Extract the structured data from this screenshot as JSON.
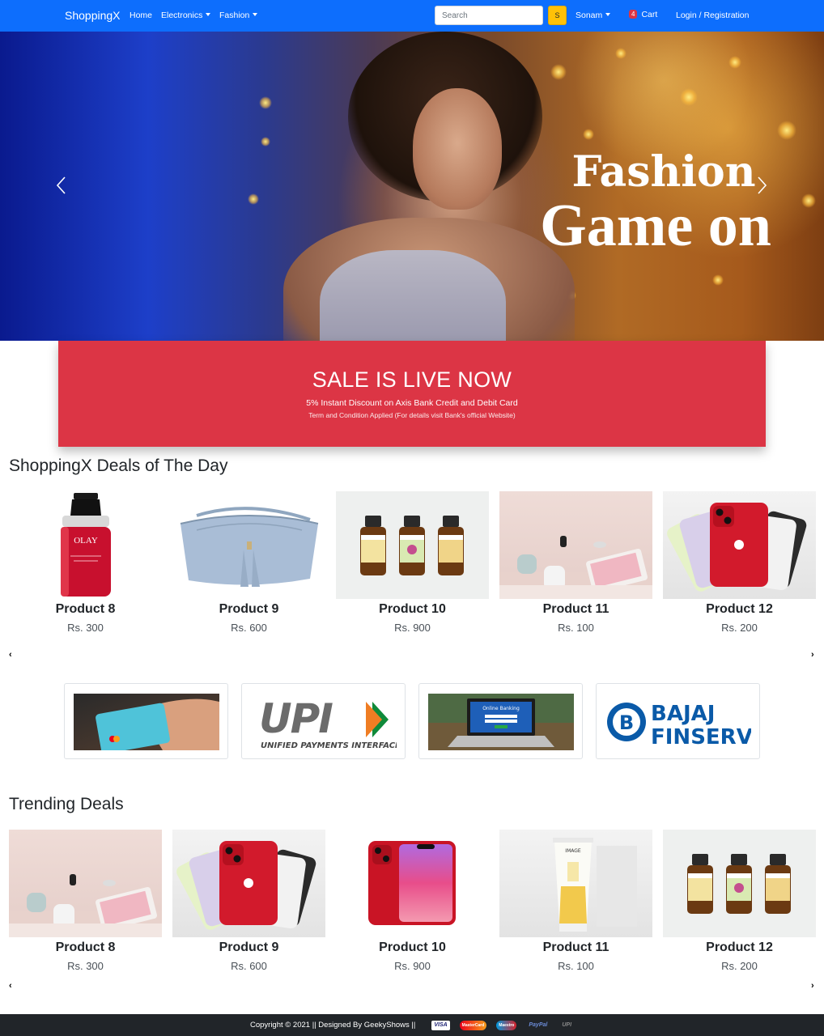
{
  "navbar": {
    "brand": "ShoppingX",
    "links": {
      "home": "Home",
      "electronics": "Electronics",
      "fashion": "Fashion"
    },
    "search": {
      "placeholder": "Search",
      "button": "S"
    },
    "user": "Sonam",
    "cart": {
      "count": "4",
      "label": "Cart"
    },
    "login": "Login / Registration",
    "colors": {
      "navbar": "#0d6efd",
      "search_button": "#ffc107",
      "badge": "#dc3545"
    }
  },
  "hero": {
    "line1": "Fashion",
    "line2": "Game on",
    "prev_icon": "chevron-left-icon",
    "next_icon": "chevron-right-icon"
  },
  "sale": {
    "title": "SALE IS LIVE NOW",
    "subtitle": "5% Instant Discount on Axis Bank Credit and Debit Card",
    "note": "Term and Condition Applied (For details visit Bank's official Website)",
    "color": "#dc3545"
  },
  "deals": {
    "title": "ShoppingX Deals of The Day",
    "prev": "‹",
    "next": "›",
    "products": [
      {
        "name": "Product 8",
        "price": "Rs. 300",
        "image": "olay-serum-bottle"
      },
      {
        "name": "Product 9",
        "price": "Rs. 600",
        "image": "blue-handbag"
      },
      {
        "name": "Product 10",
        "price": "Rs. 900",
        "image": "essential-oil-bottles"
      },
      {
        "name": "Product 11",
        "price": "Rs. 100",
        "image": "smart-home-devices"
      },
      {
        "name": "Product 12",
        "price": "Rs. 200",
        "image": "red-iphone"
      }
    ]
  },
  "payments": {
    "items": [
      {
        "name": "card-payment-photo"
      },
      {
        "name": "upi-logo",
        "text": "UPI",
        "caption": "UNIFIED PAYMENTS INTERFACE"
      },
      {
        "name": "online-banking-laptop",
        "text": "Online Banking"
      },
      {
        "name": "bajaj-finserv-logo",
        "line1": "BAJAJ",
        "line2": "FINSERV"
      }
    ]
  },
  "trending": {
    "title": "Trending Deals",
    "prev": "‹",
    "next": "›",
    "products": [
      {
        "name": "Product 8",
        "price": "Rs. 300",
        "image": "smart-home-devices"
      },
      {
        "name": "Product 9",
        "price": "Rs. 600",
        "image": "red-iphone"
      },
      {
        "name": "Product 10",
        "price": "Rs. 900",
        "image": "red-iphone-front-back"
      },
      {
        "name": "Product 11",
        "price": "Rs. 100",
        "image": "sunscreen-tube"
      },
      {
        "name": "Product 12",
        "price": "Rs. 200",
        "image": "essential-oil-bottles"
      }
    ]
  },
  "footer": {
    "text": "Copyright © 2021 || Designed By GeekyShows ||",
    "payment_icons": [
      "VISA",
      "MasterCard",
      "Maestro",
      "PayPal",
      "UPI"
    ]
  }
}
